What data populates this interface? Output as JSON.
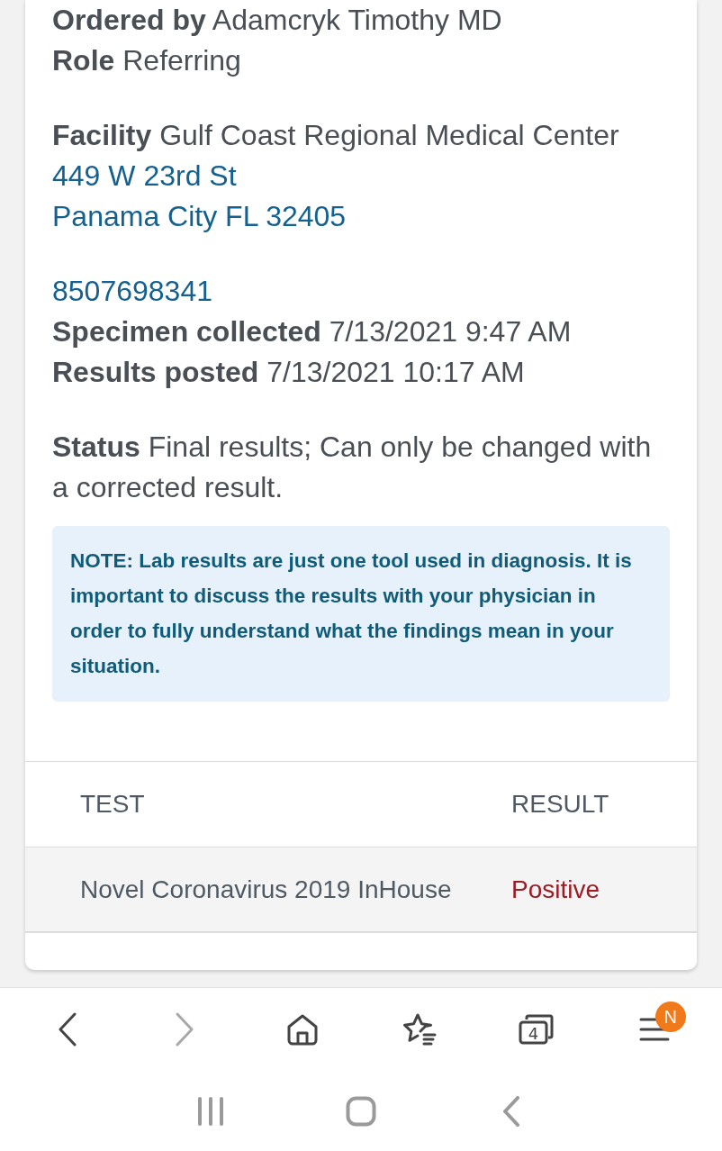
{
  "sections": [
    {
      "lines": [
        {
          "kind": "field",
          "label": "Ordered by",
          "value": "Adamcryk Timothy MD"
        },
        {
          "kind": "field",
          "label": "Role",
          "value": "Referring"
        }
      ]
    },
    {
      "lines": [
        {
          "kind": "field",
          "label": "Facility",
          "value": "Gulf Coast Regional Medical Center"
        },
        {
          "kind": "link",
          "value": "449 W 23rd St"
        },
        {
          "kind": "link",
          "value": "Panama City FL 32405"
        }
      ]
    },
    {
      "lines": [
        {
          "kind": "link",
          "value": "8507698341"
        },
        {
          "kind": "field",
          "label": "Specimen collected",
          "value": "7/13/2021 9:47 AM"
        },
        {
          "kind": "field",
          "label": "Results posted",
          "value": "7/13/2021 10:17 AM"
        }
      ]
    },
    {
      "lines": [
        {
          "kind": "field",
          "label": "Status",
          "value": "Final results; Can only be changed with a corrected result."
        }
      ]
    }
  ],
  "note": "NOTE: Lab results are just one tool used in diagnosis. It is important to discuss the results with your physician in order to fully understand what the findings mean in your situation.",
  "table": {
    "columns": [
      "TEST",
      "RESULT"
    ],
    "rows": [
      {
        "test": "Novel Coronavirus 2019 InHouse",
        "result": "Positive",
        "abnormal": true
      }
    ]
  },
  "toolbar": {
    "items": [
      {
        "kind": "back",
        "disabled": false
      },
      {
        "kind": "forward",
        "disabled": true
      },
      {
        "kind": "home",
        "disabled": false
      },
      {
        "kind": "bookmarks",
        "disabled": false
      },
      {
        "kind": "tabs",
        "disabled": false,
        "count": "4"
      },
      {
        "kind": "menu",
        "disabled": false,
        "badge": "N"
      }
    ]
  },
  "nav_bar": {
    "items": [
      {
        "kind": "recents"
      },
      {
        "kind": "home"
      },
      {
        "kind": "back"
      }
    ]
  }
}
